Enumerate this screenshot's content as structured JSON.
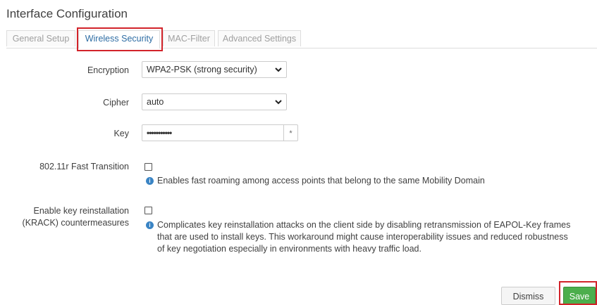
{
  "title": "Interface Configuration",
  "tabs": [
    {
      "label": "General Setup"
    },
    {
      "label": "Wireless Security"
    },
    {
      "label": "MAC-Filter"
    },
    {
      "label": "Advanced Settings"
    }
  ],
  "active_tab": "Wireless Security",
  "form": {
    "encryption": {
      "label": "Encryption",
      "value": "WPA2-PSK (strong security)"
    },
    "cipher": {
      "label": "Cipher",
      "value": "auto"
    },
    "key": {
      "label": "Key",
      "value": "•••••••••••",
      "reveal_symbol": "*"
    },
    "fast_transition": {
      "label": "802.11r Fast Transition",
      "checked": false,
      "help": "Enables fast roaming among access points that belong to the same Mobility Domain"
    },
    "krack": {
      "label_line1": "Enable key reinstallation",
      "label_line2": "(KRACK) countermeasures",
      "checked": false,
      "help_line1": "Complicates key reinstallation attacks on the client side by disabling retransmission of EAPOL-Key frames",
      "help_line2": "that are used to install keys. This workaround might cause interoperability issues and reduced robustness",
      "help_line3": "of key negotiation especially in environments with heavy traffic load."
    }
  },
  "buttons": {
    "dismiss": "Dismiss",
    "save": "Save"
  },
  "colors": {
    "highlight": "#d2232a",
    "save": "#4cae4c",
    "active_tab_text": "#2e6da4",
    "info_icon": "#3a84c4"
  },
  "icons": {
    "help": "info-icon",
    "dropdown": "chevron-down-icon"
  }
}
